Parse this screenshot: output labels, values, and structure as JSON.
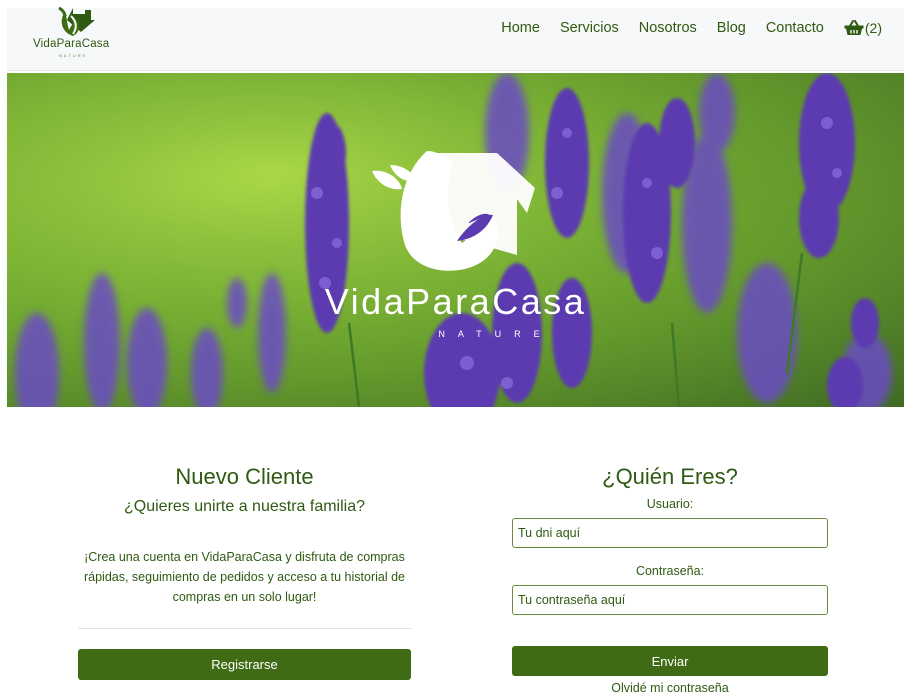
{
  "brand": {
    "name": "VidaParaCasa",
    "tagline": "NATURE"
  },
  "nav": {
    "items": [
      {
        "label": "Home"
      },
      {
        "label": "Servicios"
      },
      {
        "label": "Nosotros"
      },
      {
        "label": "Blog"
      },
      {
        "label": "Contacto"
      }
    ],
    "cart_count": "(2)"
  },
  "hero": {
    "title": "VidaParaCasa",
    "subtitle": "NATURE"
  },
  "register": {
    "heading": "Nuevo Cliente",
    "subheading": "¿Quieres unirte a nuestra familia?",
    "text": "¡Crea una cuenta en VidaParaCasa y disfruta de compras rápidas, seguimiento de pedidos y acceso a tu historial de compras en un solo lugar!",
    "button": "Registrarse"
  },
  "login": {
    "heading": "¿Quién Eres?",
    "user_label": "Usuario:",
    "user_placeholder": "Tu dni aquí",
    "password_label": "Contraseña:",
    "password_placeholder": "Tu contraseña aquí",
    "button": "Enviar",
    "forgot": "Olvidé mi contraseña"
  },
  "colors": {
    "primary": "#3e6b13",
    "text": "#2f5a12",
    "nav_bg": "#f7f8f9"
  },
  "icons": {
    "logo": "leaf-house-icon",
    "cart": "basket-icon"
  }
}
